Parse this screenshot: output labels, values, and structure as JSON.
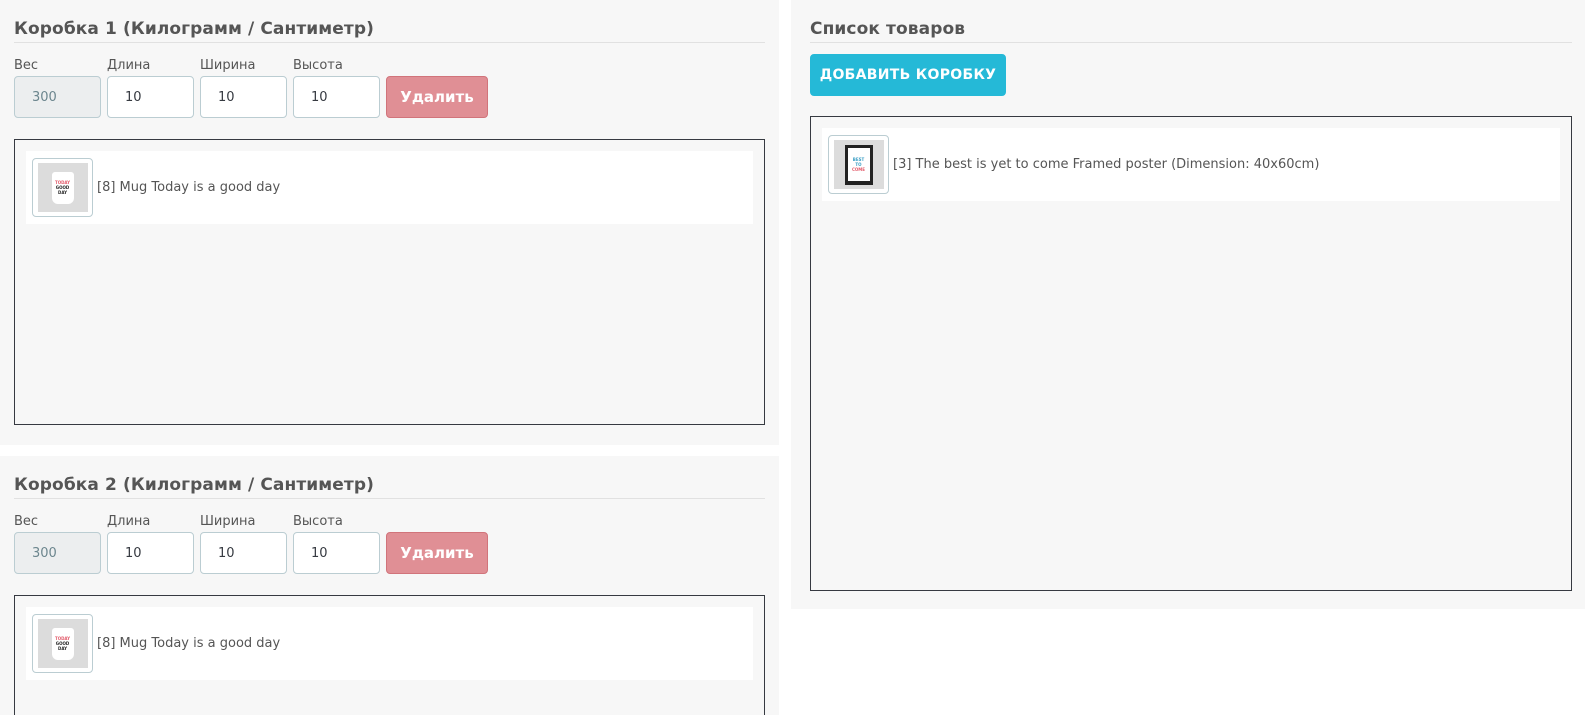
{
  "boxes": [
    {
      "title": "Коробка 1 (Килограмм / Сантиметр)",
      "weight_label": "Вес",
      "length_label": "Длина",
      "width_label": "Ширина",
      "height_label": "Высота",
      "weight_value": "300",
      "length_value": "10",
      "width_value": "10",
      "height_value": "10",
      "delete_label": "Удалить",
      "products": [
        {
          "label": "[8] Mug Today is a good day",
          "thumb_icon": "mug-image-icon"
        }
      ]
    },
    {
      "title": "Коробка 2 (Килограмм / Сантиметр)",
      "weight_label": "Вес",
      "length_label": "Длина",
      "width_label": "Ширина",
      "height_label": "Высота",
      "weight_value": "300",
      "length_value": "10",
      "width_value": "10",
      "height_value": "10",
      "delete_label": "Удалить",
      "products": [
        {
          "label": "[8] Mug Today is a good day",
          "thumb_icon": "mug-image-icon"
        }
      ]
    }
  ],
  "product_list": {
    "title": "Список товаров",
    "add_box_label": "ДОБАВИТЬ КОРОБКУ",
    "items": [
      {
        "label": "[3] The best is yet to come Framed poster (Dimension: 40x60cm)",
        "thumb_icon": "poster-image-icon"
      }
    ]
  },
  "thumbnails": {
    "mug": [
      "TODAY",
      "GOOD",
      "DAY"
    ],
    "poster": [
      "BEST",
      "TO",
      "COME"
    ]
  },
  "colors": {
    "panel_bg": "#f7f7f7",
    "delete_button": "#e08f95",
    "add_button": "#25b9d7",
    "text": "#363a41"
  }
}
